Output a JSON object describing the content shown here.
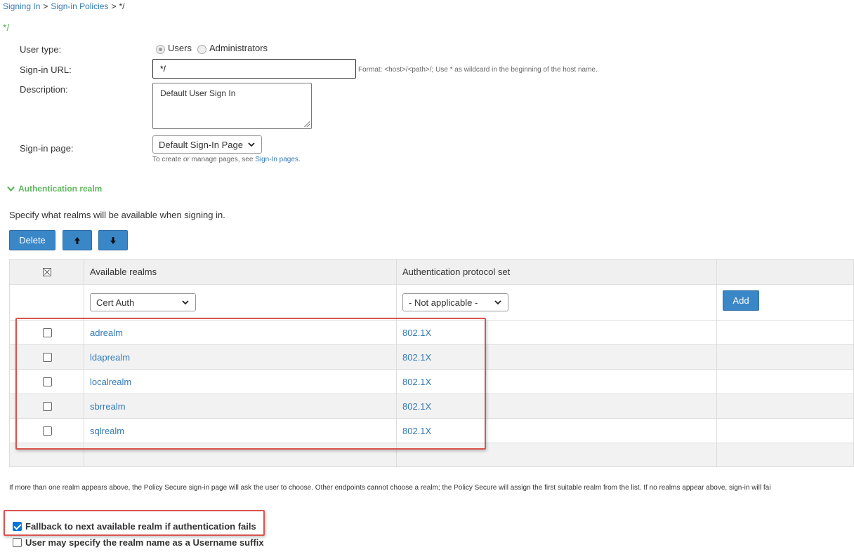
{
  "breadcrumb": [
    {
      "label": "Signing In",
      "link": true
    },
    {
      "label": "Sign-in Policies",
      "link": true
    },
    {
      "label": "*/",
      "link": false
    }
  ],
  "breadcrumb_separator": ">",
  "page_title": "*/",
  "form": {
    "user_type_label": "User type:",
    "user_type_options": [
      {
        "label": "Users",
        "selected": true
      },
      {
        "label": "Administrators",
        "selected": false
      }
    ],
    "signin_url_label": "Sign-in URL:",
    "signin_url_value": "*/",
    "signin_url_hint": "Format: <host>/<path>/;   Use * as wildcard in the beginning of the host name.",
    "description_label": "Description:",
    "description_value": "Default User Sign In",
    "signin_page_label": "Sign-in page:",
    "signin_page_value": "Default Sign-In Page",
    "signin_page_hint_prefix": "To create or manage pages, see ",
    "signin_page_hint_link": "Sign-In pages",
    "signin_page_hint_suffix": "."
  },
  "auth_realm": {
    "section_title": "Authentication realm",
    "description": "Specify what realms will be available when signing in.",
    "buttons": {
      "delete": "Delete",
      "up": "up-arrow",
      "down": "down-arrow",
      "add": "Add"
    },
    "columns": [
      "Available realms",
      "Authentication protocol set"
    ],
    "new_row": {
      "realm_select": "Cert Auth",
      "protocol_select": "- Not applicable -"
    },
    "rows": [
      {
        "realm": "adrealm",
        "protocol": "802.1X",
        "checked": false
      },
      {
        "realm": "ldaprealm",
        "protocol": "802.1X",
        "checked": false
      },
      {
        "realm": "localrealm",
        "protocol": "802.1X",
        "checked": false
      },
      {
        "realm": "sbrrealm",
        "protocol": "802.1X",
        "checked": false
      },
      {
        "realm": "sqlrealm",
        "protocol": "802.1X",
        "checked": false
      }
    ],
    "footnote": "If more than one realm appears above, the Policy Secure sign-in page will ask the user to choose. Other endpoints cannot choose a realm; the Policy Secure will assign the first suitable realm from the list. If no realms appear above, sign-in will fai",
    "options": [
      {
        "label": "Fallback to next available realm if authentication fails",
        "checked": true
      },
      {
        "label": "User may specify the realm name as a Username suffix",
        "checked": false
      }
    ]
  },
  "colors": {
    "link": "#337ab7",
    "accent_green": "#5cb85c",
    "button_blue": "#3a87c8",
    "highlight_red": "#d9534f"
  }
}
